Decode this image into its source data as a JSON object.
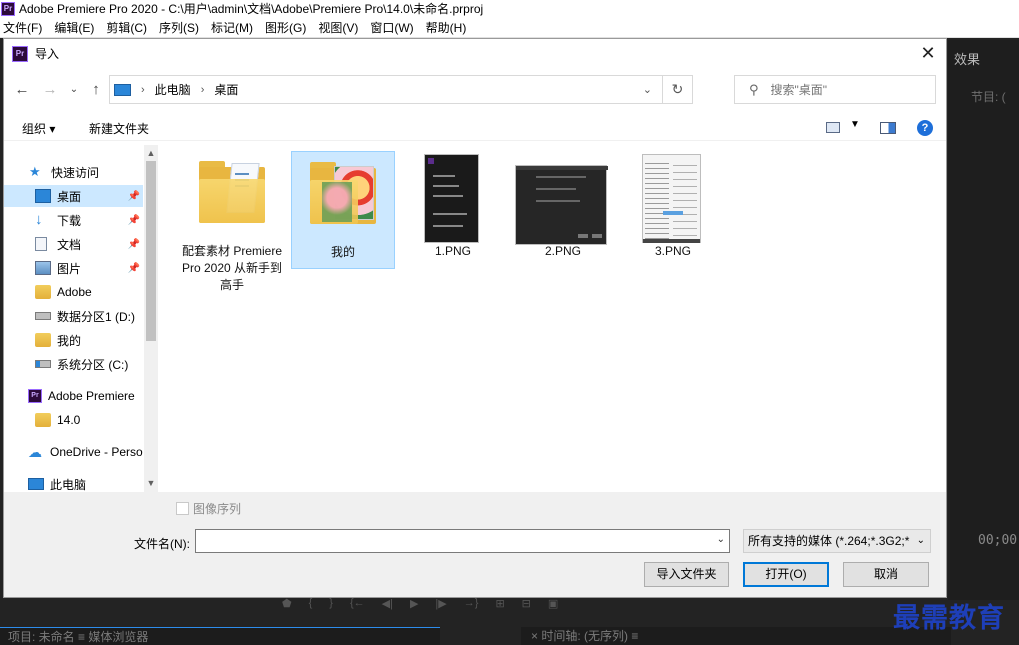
{
  "app": {
    "title": "Adobe Premiere Pro 2020 - C:\\用户\\admin\\文档\\Adobe\\Premiere Pro\\14.0\\未命名.prproj",
    "logo": "Pr",
    "menu": [
      "文件(F)",
      "编辑(E)",
      "剪辑(C)",
      "序列(S)",
      "标记(M)",
      "图形(G)",
      "视图(V)",
      "窗口(W)",
      "帮助(H)"
    ]
  },
  "background_panels": {
    "effects_tab": "效果",
    "program_tab": "节目: (",
    "timecode": "00;00;",
    "project_tab": "项目: 未命名  ≡     媒体浏览器",
    "timeline_tab": "×  时间轴: (无序列) ≡"
  },
  "watermark": "最需教育",
  "dialog": {
    "logo": "Pr",
    "title": "导入",
    "close": "✕",
    "address": {
      "crumbs": [
        "此电脑",
        "桌面"
      ],
      "separator": "›"
    },
    "search": {
      "placeholder": "搜索\"桌面\""
    },
    "toolbar": {
      "organize": "组织 ▾",
      "new_folder": "新建文件夹",
      "help": "?"
    },
    "sidebar": [
      {
        "label": "快速访问",
        "icon": "star-icon",
        "group": true
      },
      {
        "label": "桌面",
        "icon": "desktop-icon",
        "pinned": true,
        "selected": true
      },
      {
        "label": "下载",
        "icon": "download-icon",
        "pinned": true
      },
      {
        "label": "文档",
        "icon": "document-icon",
        "pinned": true
      },
      {
        "label": "图片",
        "icon": "picture-icon",
        "pinned": true
      },
      {
        "label": "Adobe",
        "icon": "folder-icon"
      },
      {
        "label": "数据分区1 (D:)",
        "icon": "drive-icon"
      },
      {
        "label": "我的",
        "icon": "folder-icon"
      },
      {
        "label": "系统分区 (C:)",
        "icon": "system-drive-icon"
      },
      {
        "label": "Adobe Premiere",
        "icon": "premiere-icon",
        "group": true
      },
      {
        "label": "14.0",
        "icon": "folder-icon"
      },
      {
        "label": "OneDrive - Perso",
        "icon": "onedrive-icon",
        "group": true
      },
      {
        "label": "此电脑",
        "icon": "computer-icon",
        "group": true
      }
    ],
    "files": [
      {
        "label": "配套素材 Premiere Pro 2020 从新手到高手",
        "kind": "folder"
      },
      {
        "label": "我的",
        "kind": "folder",
        "selected": true
      },
      {
        "label": "1.PNG",
        "kind": "image"
      },
      {
        "label": "2.PNG",
        "kind": "image"
      },
      {
        "label": "3.PNG",
        "kind": "image"
      }
    ],
    "image_sequence_label": "图像序列",
    "filename_label": "文件名(N):",
    "filename_value": "",
    "filter_value": "所有支持的媒体 (*.264;*.3G2;*",
    "buttons": {
      "import_folder": "导入文件夹",
      "open": "打开(O)",
      "cancel": "取消"
    }
  },
  "colors": {
    "selection": "#cce8ff",
    "premiere_bg": "#232323",
    "accent": "#0078d7",
    "watermark": "#1e3fb8"
  }
}
